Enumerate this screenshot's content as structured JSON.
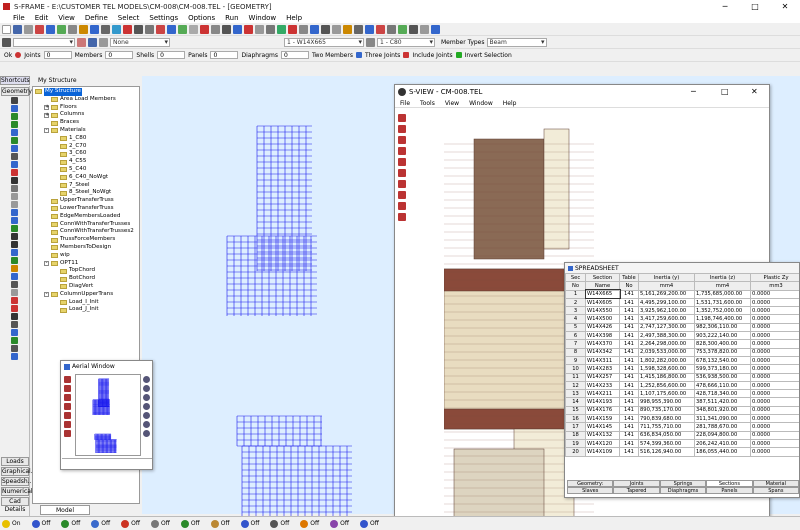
{
  "title": "S-FRAME - E:\\CUSTOMER TEL MODELS\\CM-008\\CM-008.TEL - [GEOMETRY]",
  "menu": [
    "File",
    "Edit",
    "View",
    "Define",
    "Select",
    "Settings",
    "Options",
    "Run",
    "Window",
    "Help"
  ],
  "toolbar": {
    "section_dropdown": "1 - W14X665",
    "material_dropdown": "1 - C80",
    "member_types_label": "Member Types",
    "member_types_value": "Beam",
    "none_dropdown": "None"
  },
  "selection_bar": {
    "ok": "Ok",
    "joints_label": "Joints",
    "joints_value": "0",
    "members_label": "Members",
    "members_value": "0",
    "shells_label": "Shells",
    "shells_value": "0",
    "panels_label": "Panels",
    "panels_value": "0",
    "diaphragms_label": "Diaphragms",
    "diaphragms_value": "0",
    "two_members": "Two Members",
    "three_joints": "Three Joints",
    "include_joints": "Include Joints",
    "invert_selection": "Invert Selection"
  },
  "left": {
    "shortcuts_tab": "Shortcuts",
    "structure_tab": "My Structure",
    "geometry_tab": "Geometry",
    "bottom_tabs": [
      "Loads",
      "Graphical...",
      "Speadsh...",
      "Numerical...",
      "Cad Details"
    ]
  },
  "tree": {
    "items": [
      {
        "label": "My Structure",
        "level": 0,
        "selected": true
      },
      {
        "label": "Area Load Members",
        "level": 1
      },
      {
        "label": "Floors",
        "level": 1,
        "exp": "+"
      },
      {
        "label": "Columns",
        "level": 1,
        "exp": "+"
      },
      {
        "label": "Braces",
        "level": 1
      },
      {
        "label": "Materials",
        "level": 1,
        "exp": "-"
      },
      {
        "label": "1_C80",
        "level": 2
      },
      {
        "label": "2_C70",
        "level": 2
      },
      {
        "label": "3_C60",
        "level": 2
      },
      {
        "label": "4_C55",
        "level": 2
      },
      {
        "label": "5_C40",
        "level": 2
      },
      {
        "label": "6_C40_NoWgt",
        "level": 2
      },
      {
        "label": "7_Steel",
        "level": 2
      },
      {
        "label": "8_Steel_NoWgt",
        "level": 2
      },
      {
        "label": "UpperTransferTruss",
        "level": 1
      },
      {
        "label": "LowerTransferTruss",
        "level": 1
      },
      {
        "label": "EdgeMembersLoaded",
        "level": 1
      },
      {
        "label": "ConnWithTransferTrusses",
        "level": 1
      },
      {
        "label": "ConnWithTransferTrusses2",
        "level": 1
      },
      {
        "label": "TrussForceMembers",
        "level": 1
      },
      {
        "label": "MembersToDesign",
        "level": 1
      },
      {
        "label": "wip",
        "level": 1
      },
      {
        "label": "OPT11",
        "level": 1,
        "exp": "-"
      },
      {
        "label": "TopChord",
        "level": 2
      },
      {
        "label": "BotChord",
        "level": 2
      },
      {
        "label": "DiagVert",
        "level": 2
      },
      {
        "label": "ColumnUpperTrans",
        "level": 1,
        "exp": "-"
      },
      {
        "label": "Load_I_Init",
        "level": 2
      },
      {
        "label": "Load_J_Init",
        "level": 2
      }
    ],
    "model_organizer_tab": "Model Organizer"
  },
  "aerial": {
    "title": "Aerial Window"
  },
  "sview": {
    "title": "S-VIEW - CM-008.TEL",
    "menu": [
      "File",
      "Tools",
      "View",
      "Window",
      "Help"
    ]
  },
  "spreadsheet": {
    "title": "SPREADSHEET",
    "headers": [
      [
        "Sec",
        "No"
      ],
      [
        "Section",
        "Name"
      ],
      [
        "Table",
        "No"
      ],
      [
        "Inertia (y)",
        "mm4"
      ],
      [
        "Inertia (z)",
        "mm4"
      ],
      [
        "Plastic Zy",
        "mm3"
      ]
    ],
    "rows": [
      [
        "1",
        "W14X665",
        "141",
        "5,161,269,200.00",
        "1,735,685,000.00",
        "0.0000"
      ],
      [
        "2",
        "W14X605",
        "141",
        "4,495,299,100.00",
        "1,531,731,600.00",
        "0.0000"
      ],
      [
        "3",
        "W14X550",
        "141",
        "3,925,962,100.00",
        "1,352,752,000.00",
        "0.0000"
      ],
      [
        "4",
        "W14X500",
        "141",
        "3,417,259,600.00",
        "1,198,746,400.00",
        "0.0000"
      ],
      [
        "5",
        "W14X426",
        "141",
        "2,747,127,300.00",
        "982,306,110.00",
        "0.0000"
      ],
      [
        "6",
        "W14X398",
        "141",
        "2,497,388,300.00",
        "903,222,140.00",
        "0.0000"
      ],
      [
        "7",
        "W14X370",
        "141",
        "2,264,298,000.00",
        "828,300,400.00",
        "0.0000"
      ],
      [
        "8",
        "W14X342",
        "141",
        "2,039,533,000.00",
        "753,378,820.00",
        "0.0000"
      ],
      [
        "9",
        "W14X311",
        "141",
        "1,802,282,000.00",
        "678,132,540.00",
        "0.0000"
      ],
      [
        "10",
        "W14X283",
        "141",
        "1,598,328,600.00",
        "599,373,180.00",
        "0.0000"
      ],
      [
        "11",
        "W14X257",
        "141",
        "1,415,186,800.00",
        "536,938,500.00",
        "0.0000"
      ],
      [
        "12",
        "W14X233",
        "141",
        "1,252,856,600.00",
        "478,666,110.00",
        "0.0000"
      ],
      [
        "13",
        "W14X211",
        "141",
        "1,107,175,600.00",
        "428,718,340.00",
        "0.0000"
      ],
      [
        "14",
        "W14X193",
        "141",
        "998,955,390.00",
        "387,511,420.00",
        "0.0000"
      ],
      [
        "15",
        "W14X176",
        "141",
        "890,735,170.00",
        "348,801,920.00",
        "0.0000"
      ],
      [
        "16",
        "W14X159",
        "141",
        "790,839,680.00",
        "311,341,090.00",
        "0.0000"
      ],
      [
        "17",
        "W14X145",
        "141",
        "711,755,710.00",
        "281,788,670.00",
        "0.0000"
      ],
      [
        "18",
        "W14X132",
        "141",
        "636,834,050.00",
        "228,094,800.00",
        "0.0000"
      ],
      [
        "19",
        "W14X120",
        "141",
        "574,399,360.00",
        "206,242,410.00",
        "0.0000"
      ],
      [
        "20",
        "W14X109",
        "141",
        "516,126,940.00",
        "186,055,440.00",
        "0.0000"
      ]
    ],
    "tabs_row1": [
      "Geometry: Initialize",
      "Joints",
      "Springs",
      "Sections",
      "Material"
    ],
    "tabs_row2": [
      "Slaves",
      "Tapered",
      "Diaphragms",
      "Panels",
      "Spans"
    ]
  },
  "status": [
    {
      "label": "On",
      "color": "#e8c000"
    },
    {
      "label": "Off",
      "color": "#3355cc"
    },
    {
      "label": "Off",
      "color": "#2a8a2a"
    },
    {
      "label": "Off",
      "color": "#3a6acc"
    },
    {
      "label": "Off",
      "color": "#cc3322"
    },
    {
      "label": "Off",
      "color": "#777777"
    },
    {
      "label": "Off",
      "color": "#2a8a2a"
    },
    {
      "label": "Off",
      "color": "#bb8833"
    },
    {
      "label": "Off",
      "color": "#3355cc"
    },
    {
      "label": "Off",
      "color": "#555555"
    },
    {
      "label": "Off",
      "color": "#dd7700"
    },
    {
      "label": "Off",
      "color": "#8844aa"
    },
    {
      "label": "Off",
      "color": "#3355cc"
    }
  ],
  "colors": {
    "canvas": "#ddeeff",
    "wire": "#1a1aee",
    "accent": "#0a64d8"
  }
}
